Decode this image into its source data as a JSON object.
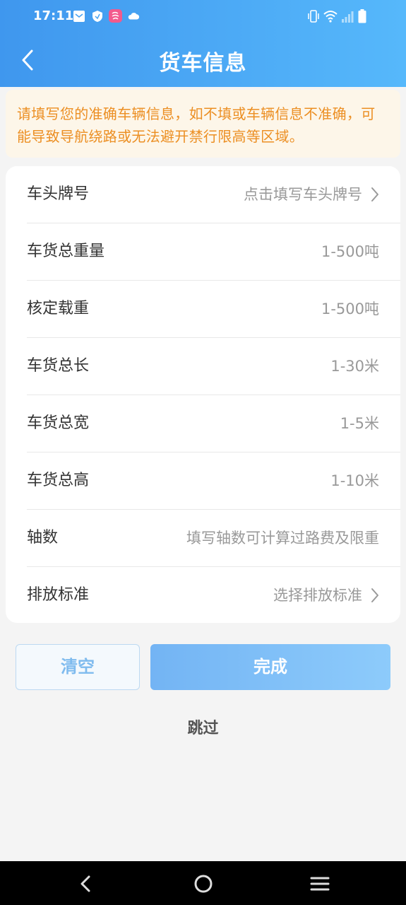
{
  "status_bar": {
    "time": "17:11"
  },
  "header": {
    "title": "货车信息"
  },
  "notice": {
    "text": "请填写您的准确车辆信息，如不填或车辆信息不准确，可能导致导航绕路或无法避开禁行限高等区域。"
  },
  "form": {
    "rows": [
      {
        "label": "车头牌号",
        "value": "点击填写车头牌号"
      },
      {
        "label": "车货总重量",
        "value": "1-500吨"
      },
      {
        "label": "核定载重",
        "value": "1-500吨"
      },
      {
        "label": "车货总长",
        "value": "1-30米"
      },
      {
        "label": "车货总宽",
        "value": "1-5米"
      },
      {
        "label": "车货总高",
        "value": "1-10米"
      },
      {
        "label": "轴数",
        "value": "填写轴数可计算过路费及限重"
      },
      {
        "label": "排放标准",
        "value": "选择排放标准"
      }
    ]
  },
  "actions": {
    "clear_label": "清空",
    "done_label": "完成",
    "skip_label": "跳过"
  },
  "colors": {
    "header_start": "#3f97ee",
    "header_end": "#56b8fb",
    "notice_text": "#ec8f23",
    "notice_bg": "#fdf6e9"
  }
}
